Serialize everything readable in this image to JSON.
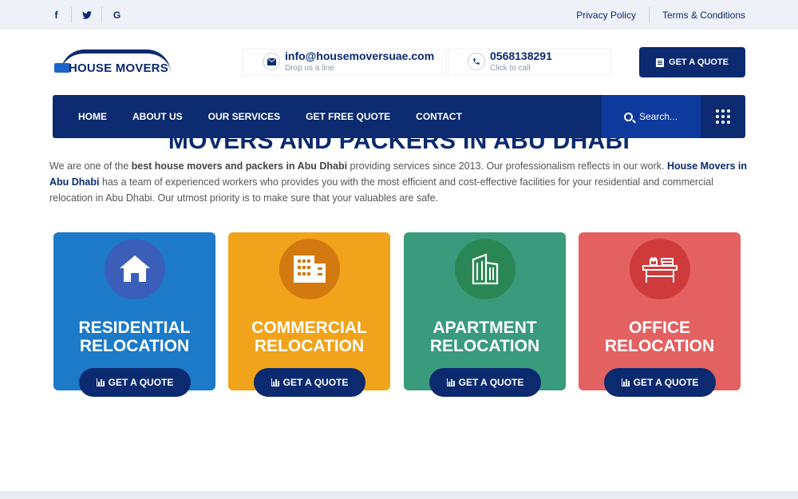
{
  "topbar": {
    "social": [
      {
        "glyph": "f",
        "icon": "facebook-icon"
      },
      {
        "glyph": "t",
        "icon": "twitter-icon"
      },
      {
        "glyph": "G",
        "icon": "google-icon"
      }
    ],
    "links": [
      "Privacy Policy",
      "Terms & Conditions"
    ]
  },
  "header": {
    "logo_text": "HOUSE MOVERS",
    "email": {
      "value": "info@housemoversuae.com",
      "sub": "Drop us a line",
      "icon": "envelope-icon"
    },
    "phone": {
      "value": "0568138291",
      "sub": "Click to call",
      "icon": "phone-icon"
    },
    "quote_label": "GET A QUOTE"
  },
  "nav": {
    "items": [
      "HOME",
      "ABOUT US",
      "OUR SERVICES",
      "GET FREE QUOTE",
      "CONTACT"
    ],
    "search_placeholder": "Search..."
  },
  "main": {
    "heading": "MOVERS AND PACKERS IN ABU DHABI",
    "para": {
      "p1": "We are one of the ",
      "b1": "best house movers and packers in Abu Dhabi",
      "p2": " providing services since 2013. Our professionalism reflects in our work. ",
      "b2": "House Movers in Abu Dhabi",
      "p3": " has a team of experienced workers who provides you with the most efficient and cost-effective facilities for your residential and commercial relocation in Abu Dhabi. Our utmost priority is to make sure that your valuables are safe."
    }
  },
  "cards": [
    {
      "line1": "RESIDENTIAL",
      "line2": "RELOCATION",
      "button": "GET A QUOTE",
      "icon": "house-icon",
      "color": "#1c7ac8"
    },
    {
      "line1": "COMMERCIAL",
      "line2": "RELOCATION",
      "button": "GET A QUOTE",
      "icon": "building-icon",
      "color": "#f0a31b"
    },
    {
      "line1": "APARTMENT",
      "line2": "RELOCATION",
      "button": "GET A QUOTE",
      "icon": "apartment-icon",
      "color": "#3a9a7c"
    },
    {
      "line1": "OFFICE",
      "line2": "RELOCATION",
      "button": "GET A QUOTE",
      "icon": "office-desk-icon",
      "color": "#e36161"
    }
  ],
  "colors": {
    "brand": "#0b2a6f",
    "nav_search": "#0d3a9c"
  }
}
